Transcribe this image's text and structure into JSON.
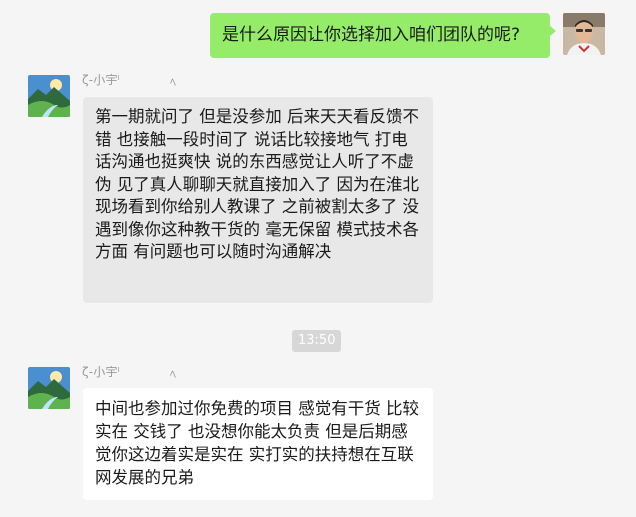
{
  "messages": [
    {
      "direction": "outgoing",
      "text": "是什么原因让你选择加入咱们团队的呢?",
      "avatar": "user-photo-avatar"
    },
    {
      "direction": "incoming",
      "sender": "ζ-小宇ˡ",
      "sender_deco": "ﾍ",
      "text": "第一期就问了 但是没参加 后来天天看反馈不错 也接触一段时间了 说话比较接地气 打电话沟通也挺爽快 说的东西感觉让人听了不虚伪 见了真人聊聊天就直接加入了 因为在淮北现场看到你给别人教课了 之前被割太多了 没遇到像你这种教干货的 毫无保留 模式技术各方面 有问题也可以随时沟通解决",
      "avatar": "landscape-avatar"
    },
    {
      "direction": "incoming",
      "sender": "ζ-小宇ˡ",
      "sender_deco": "ﾍ",
      "text": "中间也参加过你免费的项目 感觉有干货 比较实在 交钱了 也没想你能太负责 但是后期感觉你这边着实是实在 实打实的扶持想在互联网发展的兄弟",
      "avatar": "landscape-avatar"
    }
  ],
  "timestamp": "13:50",
  "colors": {
    "background": "#f5f5f5",
    "outgoing_bubble": "#95ec69",
    "incoming_bubble_grey": "#e8e8e8",
    "incoming_bubble_white": "#ffffff",
    "timestamp_bg": "#d7d7d7"
  }
}
